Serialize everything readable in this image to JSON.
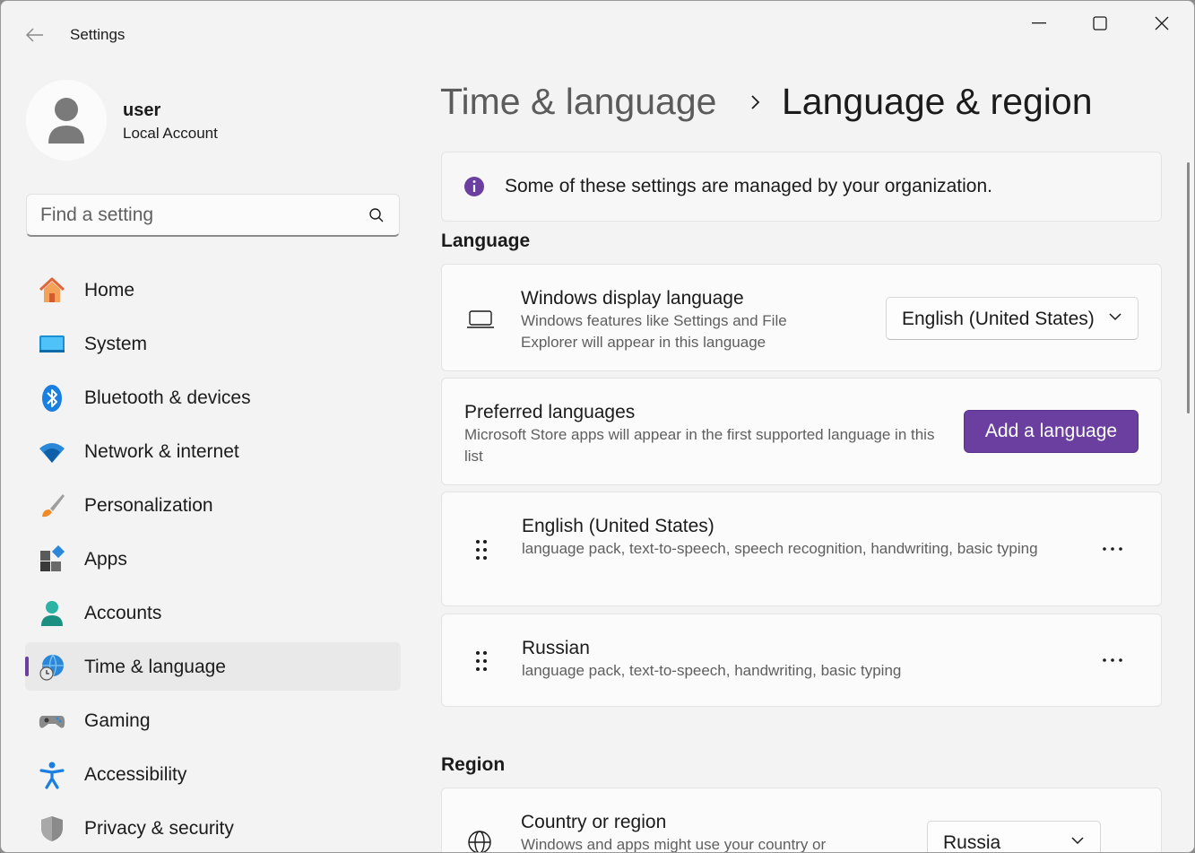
{
  "window": {
    "title": "Settings"
  },
  "user": {
    "name": "user",
    "account_type": "Local Account"
  },
  "search": {
    "placeholder": "Find a setting",
    "value": ""
  },
  "nav": [
    {
      "label": "Home",
      "icon": "home-icon"
    },
    {
      "label": "System",
      "icon": "system-icon"
    },
    {
      "label": "Bluetooth & devices",
      "icon": "bluetooth-icon"
    },
    {
      "label": "Network & internet",
      "icon": "wifi-icon"
    },
    {
      "label": "Personalization",
      "icon": "brush-icon"
    },
    {
      "label": "Apps",
      "icon": "apps-icon"
    },
    {
      "label": "Accounts",
      "icon": "accounts-icon"
    },
    {
      "label": "Time & language",
      "icon": "globe-clock-icon",
      "active": true
    },
    {
      "label": "Gaming",
      "icon": "gamepad-icon"
    },
    {
      "label": "Accessibility",
      "icon": "accessibility-icon"
    },
    {
      "label": "Privacy & security",
      "icon": "shield-icon"
    }
  ],
  "breadcrumb": {
    "parent": "Time & language",
    "current": "Language & region"
  },
  "notice": {
    "text": "Some of these settings are managed by your organization."
  },
  "language": {
    "section_title": "Language",
    "display_language": {
      "title": "Windows display language",
      "description": "Windows features like Settings and File Explorer will appear in this language",
      "selected": "English (United States)"
    },
    "preferred": {
      "title": "Preferred languages",
      "description": "Microsoft Store apps will appear in the first supported language in this list",
      "button_label": "Add a language"
    },
    "installed": [
      {
        "name": "English (United States)",
        "features": "language pack, text-to-speech, speech recognition, handwriting, basic typing"
      },
      {
        "name": "Russian",
        "features": "language pack, text-to-speech, handwriting, basic typing"
      }
    ]
  },
  "region": {
    "section_title": "Region",
    "country": {
      "title": "Country or region",
      "description": "Windows and apps might use your country or",
      "selected": "Russia"
    }
  },
  "colors": {
    "accent": "#6b3fa0",
    "background": "#f3f3f3",
    "card": "#fbfbfb"
  }
}
